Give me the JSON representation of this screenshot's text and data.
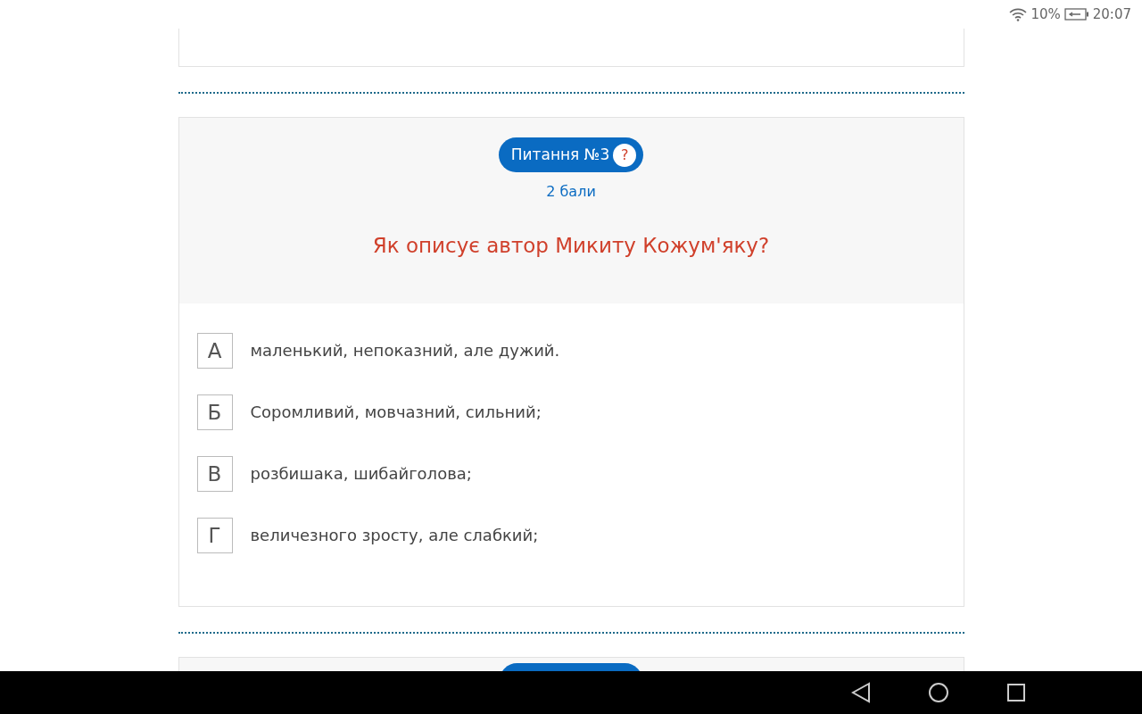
{
  "status_bar": {
    "battery": "10%",
    "time": "20:07"
  },
  "question": {
    "title": "Питання №3",
    "help": "?",
    "points": "2 бали",
    "text": "Як описує автор Микиту Кожум'яку?",
    "options": [
      {
        "letter": "А",
        "text": "маленький, непоказний, але дужий."
      },
      {
        "letter": "Б",
        "text": "Соромливий, мовчазний, сильний;"
      },
      {
        "letter": "В",
        "text": "розбишака, шибайголова;"
      },
      {
        "letter": "Г",
        "text": "величезного зросту, але слабкий;"
      }
    ]
  }
}
